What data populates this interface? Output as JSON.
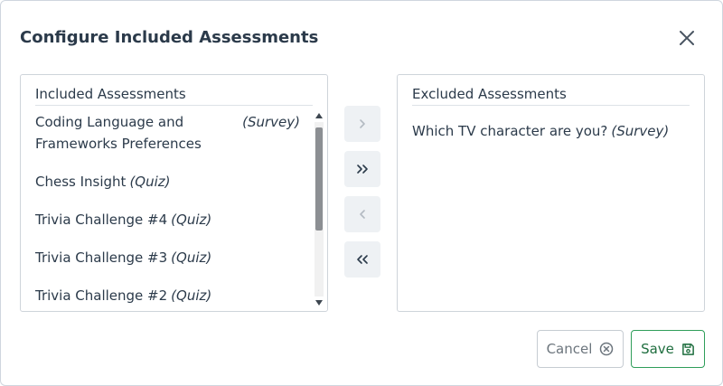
{
  "dialog": {
    "title": "Configure Included Assessments"
  },
  "included": {
    "header": "Included Assessments",
    "items": [
      {
        "name": "Coding Language and Frameworks Preferences",
        "type": "(Survey)"
      },
      {
        "name": "Chess Insight",
        "type": "(Quiz)"
      },
      {
        "name": "Trivia Challenge #4",
        "type": "(Quiz)"
      },
      {
        "name": "Trivia Challenge #3",
        "type": "(Quiz)"
      },
      {
        "name": "Trivia Challenge #2",
        "type": "(Quiz)"
      }
    ]
  },
  "excluded": {
    "header": "Excluded Assessments",
    "items": [
      {
        "name": "Which TV character are you?",
        "type": "(Survey)"
      }
    ]
  },
  "actions": {
    "cancel_label": "Cancel",
    "save_label": "Save"
  },
  "icons": {
    "close": "close-icon",
    "move_right": "chevron-right-icon",
    "move_all_right": "double-chevron-right-icon",
    "move_left": "chevron-left-icon",
    "move_all_left": "double-chevron-left-icon",
    "cancel": "circle-x-icon",
    "save": "floppy-disk-icon"
  },
  "colors": {
    "save_border": "#2f9e5a",
    "save_text": "#1f6e3f",
    "move_button_bg": "#eef1f4"
  }
}
